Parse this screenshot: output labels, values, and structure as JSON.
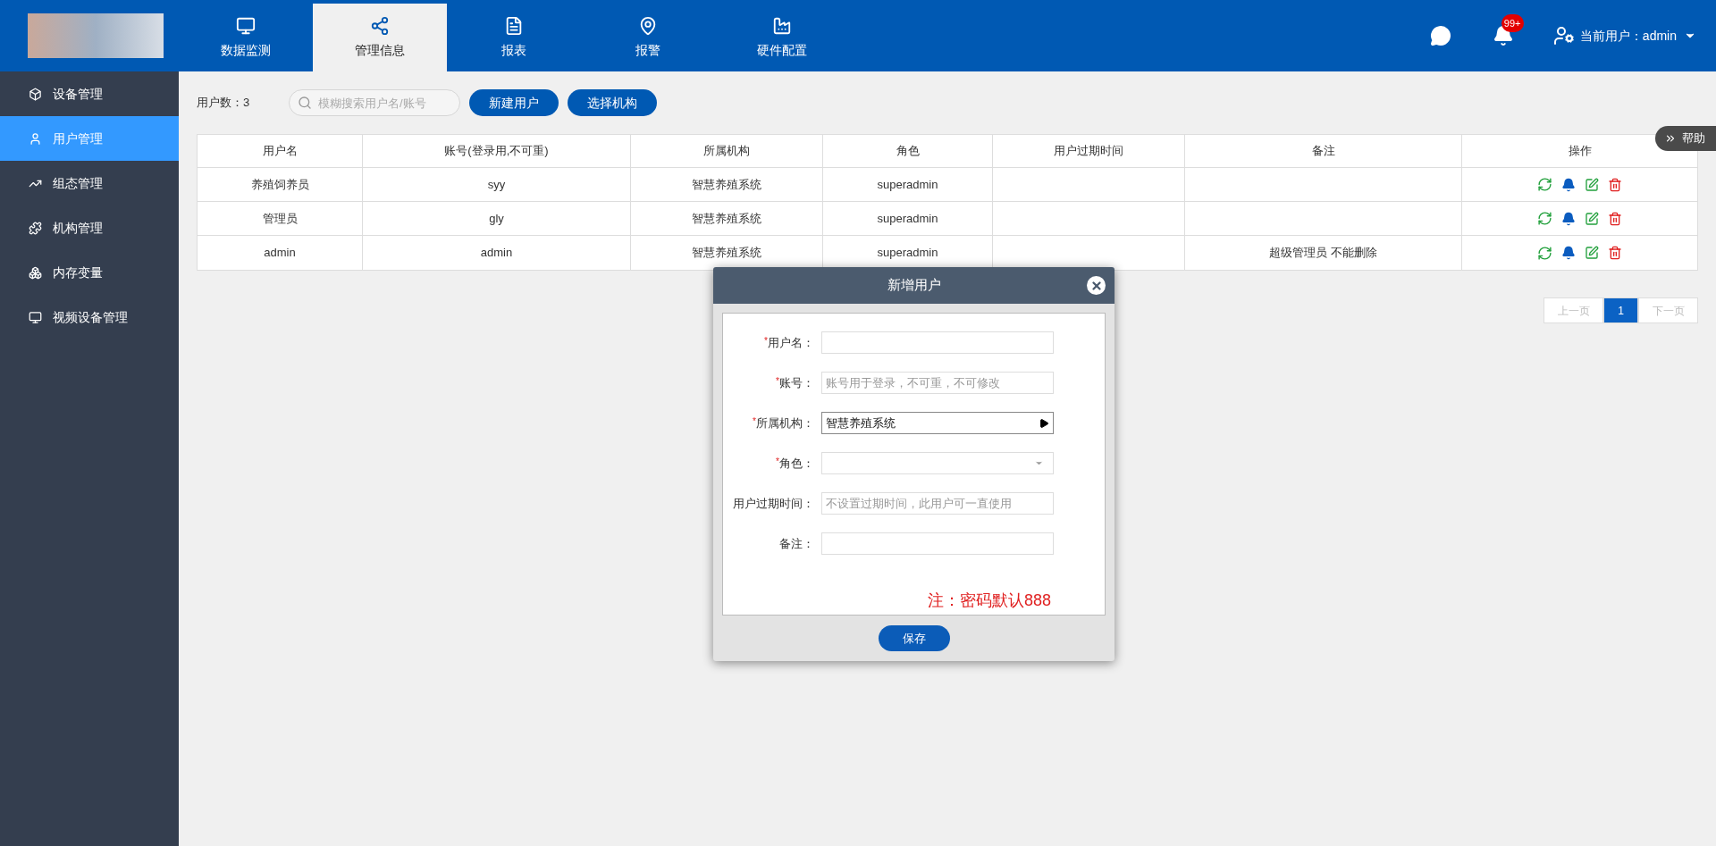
{
  "nav": {
    "tabs": [
      {
        "label": "数据监测",
        "selected": false
      },
      {
        "label": "管理信息",
        "selected": true
      },
      {
        "label": "报表",
        "selected": false
      },
      {
        "label": "报警",
        "selected": false
      },
      {
        "label": "硬件配置",
        "selected": false
      }
    ],
    "notifications_badge": "99+",
    "current_user": "当前用户：admin"
  },
  "sidebar": {
    "items": [
      {
        "label": "设备管理",
        "selected": false
      },
      {
        "label": "用户管理",
        "selected": true
      },
      {
        "label": "组态管理",
        "selected": false
      },
      {
        "label": "机构管理",
        "selected": false
      },
      {
        "label": "内存变量",
        "selected": false
      },
      {
        "label": "视频设备管理",
        "selected": false
      }
    ]
  },
  "toolbar": {
    "user_count": "用户数：3",
    "search": {
      "placeholder": "模糊搜索用户名/账号"
    },
    "buttons": [
      "新建用户",
      "选择机构"
    ]
  },
  "help_tab": "帮助",
  "table": {
    "columns": [
      "用户名",
      "账号(登录用,不可重)",
      "所属机构",
      "角色",
      "用户过期时间",
      "备注",
      "操作"
    ],
    "rows": [
      {
        "cells": [
          "养殖饲养员",
          "syy",
          "智慧养殖系统",
          "superadmin",
          "",
          ""
        ]
      },
      {
        "cells": [
          "管理员",
          "gly",
          "智慧养殖系统",
          "superadmin",
          "",
          ""
        ]
      },
      {
        "cells": [
          "admin",
          "admin",
          "智慧养殖系统",
          "superadmin",
          "",
          "超级管理员 不能删除"
        ]
      }
    ]
  },
  "pagination": [
    {
      "label": "上一页",
      "kind": "prev",
      "disabled": true,
      "selected": false
    },
    {
      "label": "1",
      "kind": "page",
      "disabled": false,
      "selected": true
    },
    {
      "label": "下一页",
      "kind": "next",
      "disabled": true,
      "selected": false
    }
  ],
  "dialog": {
    "title": "新增用户",
    "fields": [
      {
        "label": "用户名：",
        "required_mark": "*",
        "kind": "input"
      },
      {
        "label": "账号：",
        "required_mark": "*",
        "kind": "input",
        "placeholder": "账号用于登录，不可重，不可修改"
      },
      {
        "label": "所属机构：",
        "required_mark": "*",
        "kind": "tree",
        "value": "智慧养殖系统"
      },
      {
        "label": "角色：",
        "required_mark": "*",
        "kind": "select"
      },
      {
        "label": "用户过期时间：",
        "kind": "input",
        "placeholder": "不设置过期时间，此用户可一直使用"
      },
      {
        "label": "备注：",
        "kind": "input"
      }
    ],
    "note": "注：密码默认888",
    "save_button": "保存"
  }
}
